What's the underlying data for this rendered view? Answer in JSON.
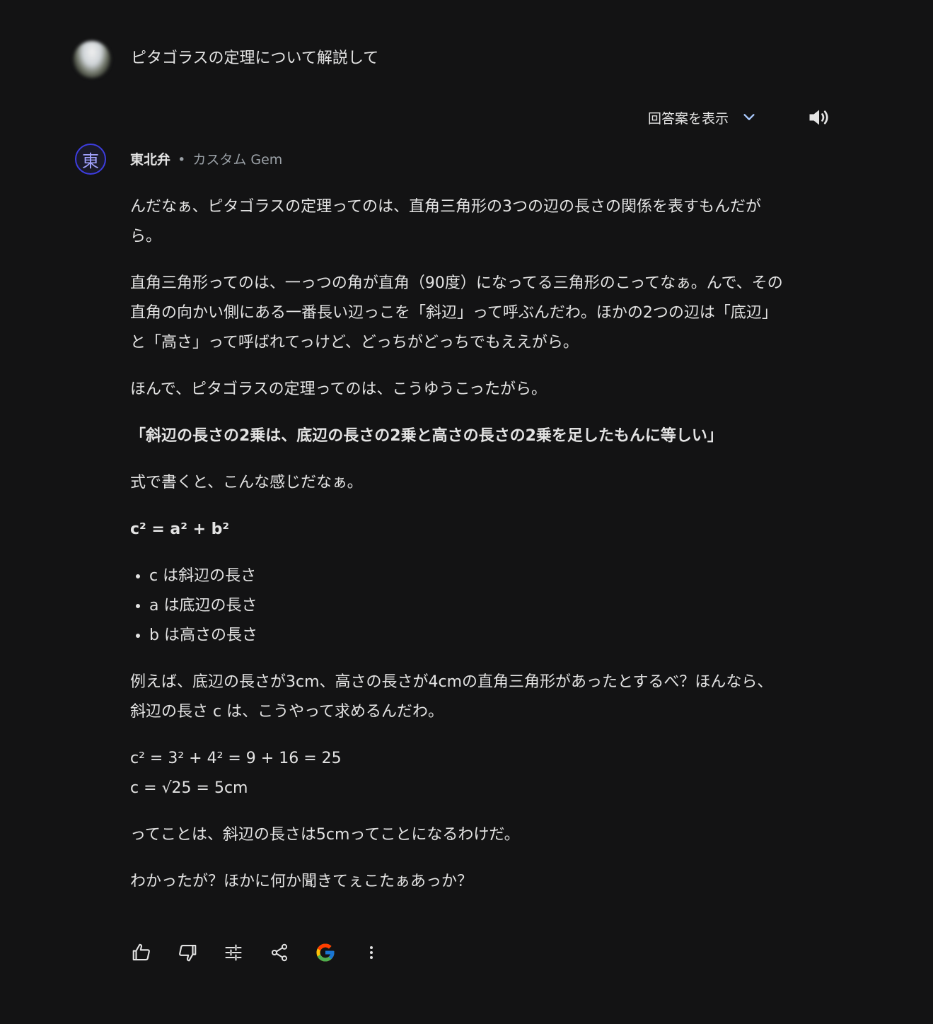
{
  "user": {
    "query": "ピタゴラスの定理について解説して"
  },
  "drafts": {
    "label": "回答案を表示"
  },
  "gem": {
    "avatar_char": "東",
    "name": "東北弁",
    "separator": "•",
    "type": "カスタム Gem"
  },
  "response": {
    "p1": "んだなぁ、ピタゴラスの定理ってのは、直角三角形の3つの辺の長さの関係を表すもんだがら。",
    "p2": "直角三角形ってのは、一っつの角が直角（90度）になってる三角形のこってなぁ。んで、その直角の向かい側にある一番長い辺っこを「斜辺」って呼ぶんだわ。ほかの2つの辺は「底辺」と「高さ」って呼ばれてっけど、どっちがどっちでもええがら。",
    "p3": "ほんで、ピタゴラスの定理ってのは、こうゆうこったがら。",
    "p4_bold": "「斜辺の長さの2乗は、底辺の長さの2乗と高さの長さの2乗を足したもんに等しい」",
    "p5": "式で書くと、こんな感じだなぁ。",
    "formula_bold": "c² = a² + b²",
    "bullets": [
      "c は斜辺の長さ",
      "a は底辺の長さ",
      "b は高さの長さ"
    ],
    "p6": "例えば、底辺の長さが3cm、高さの長さが4cmの直角三角形があったとするべ？ほんなら、斜辺の長さ c は、こうやって求めるんだわ。",
    "calc_line1": "c² = 3² + 4² = 9 + 16 = 25",
    "calc_line2": "c = √25 = 5cm",
    "p7": "ってことは、斜辺の長さは5cmってことになるわけだ。",
    "p8": "わかったが？ほかに何か聞きてぇこたぁあっか？"
  },
  "actions": [
    {
      "icon": "thumbs-up-icon"
    },
    {
      "icon": "thumbs-down-icon"
    },
    {
      "icon": "tune-icon"
    },
    {
      "icon": "share-icon"
    },
    {
      "icon": "google-icon"
    },
    {
      "icon": "more-vert-icon"
    }
  ],
  "colors": {
    "background": "#131314",
    "text": "#e3e3e3",
    "muted": "#9aa0a6",
    "gem_accent": "#3d3de0"
  }
}
